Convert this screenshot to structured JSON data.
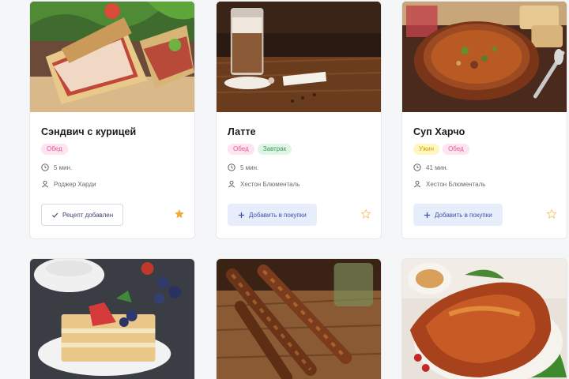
{
  "cards": [
    {
      "title": "Сэндвич с курицей",
      "tags": [
        "Обед"
      ],
      "time": "5 мин.",
      "author": "Роджер Харди",
      "button": "Рецепт добавлен",
      "favorite": true
    },
    {
      "title": "Латте",
      "tags": [
        "Обед",
        "Завтрак"
      ],
      "time": "5 мин.",
      "author": "Хестон Блюменталь",
      "button": "Добавить в покупки",
      "favorite": false
    },
    {
      "title": "Суп Харчо",
      "tags": [
        "Ужин",
        "Обед"
      ],
      "time": "41 мин.",
      "author": "Хестон Блюменталь",
      "button": "Добавить в покупки",
      "favorite": false
    }
  ],
  "colors": {
    "accent": "#3c55a8",
    "star_active": "#f2a93b",
    "star_inactive": "#f2c97a"
  },
  "icons": [
    "clock-icon",
    "user-icon",
    "check-icon",
    "plus-icon",
    "star-icon"
  ]
}
